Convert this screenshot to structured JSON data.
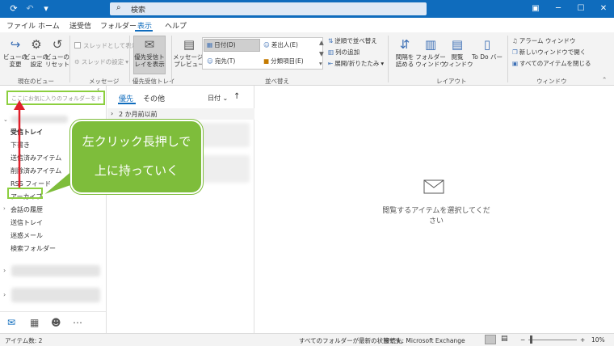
{
  "title_bar": {
    "search_placeholder": "検索",
    "icons": [
      "sync-icon",
      "undo-icon",
      "customize-icon",
      "restore-icon",
      "minimize-icon",
      "maximize-icon",
      "close-icon"
    ]
  },
  "tabs": [
    {
      "label": "ファイル"
    },
    {
      "label": "ホーム"
    },
    {
      "label": "送受信"
    },
    {
      "label": "フォルダー"
    },
    {
      "label": "表示",
      "active": true
    },
    {
      "label": "ヘルプ"
    }
  ],
  "ribbon": {
    "current_view": {
      "change_view": "ビューの\n変更",
      "view_settings": "ビューの\n設定",
      "reset_view": "ビューの\nリセット",
      "label": "現在のビュー"
    },
    "messages": {
      "show_as_threads": "スレッドとして表示",
      "thread_settings": "スレッドの設定",
      "label": "メッセージ"
    },
    "focused_inbox": {
      "show_focused": "優先受信ト\nレイを表示",
      "label": "優先受信トレイ"
    },
    "arrangement": {
      "preview": "メッセージの\nプレビュー",
      "date": "日付(D)",
      "from": "差出人(E)",
      "to": "宛先(T)",
      "categories": "分類項目(E)",
      "reverse_sort": "逆順で並べ替え",
      "add_columns": "列の追加",
      "expand_collapse": "展開/折りたたみ",
      "label": "並べ替え"
    },
    "layout": {
      "folder_pane": "フォルダー\nウィンドウ",
      "reading_pane": "閲覧\nウィンドウ",
      "todo_bar": "To Do バー",
      "compact": "間隔を\n詰める",
      "label": "レイアウト"
    },
    "window": {
      "reminders": "アラーム ウィンドウ",
      "open_new": "新しいウィンドウで開く",
      "close_all": "すべてのアイテムを閉じる",
      "label": "ウィンドウ"
    }
  },
  "folder_pane": {
    "favorites_placeholder": "ここにお気に入りのフォルダーをドラッグします",
    "folders": [
      {
        "label": "受信トレイ",
        "bold": true
      },
      {
        "label": "下書き"
      },
      {
        "label": "送信済みアイテム"
      },
      {
        "label": "削除済みアイテム"
      },
      {
        "label": "RSS フィード"
      },
      {
        "label": "アーカイブ"
      },
      {
        "label": "会話の履歴"
      },
      {
        "label": "送信トレイ"
      },
      {
        "label": "迷惑メール"
      },
      {
        "label": "検索フォルダー"
      }
    ]
  },
  "message_list": {
    "tab_focused": "優先",
    "tab_other": "その他",
    "sort_by": "日付",
    "group_header": "2 か月前以前"
  },
  "reading_pane": {
    "empty_message": "閲覧するアイテムを選択してください"
  },
  "status_bar": {
    "item_count": "アイテム数: 2",
    "sync_status": "すべてのフォルダーが最新の状態です。",
    "connection": "接続先: Microsoft Exchange",
    "zoom": "10%"
  },
  "callout": {
    "line1": "左クリック長押しで",
    "line2": "上に持っていく"
  },
  "colors": {
    "accent": "#0f6cbd",
    "highlight_green": "#8ccf3f",
    "callout_green": "#7ebd3b",
    "arrow_red": "#e0202b"
  }
}
